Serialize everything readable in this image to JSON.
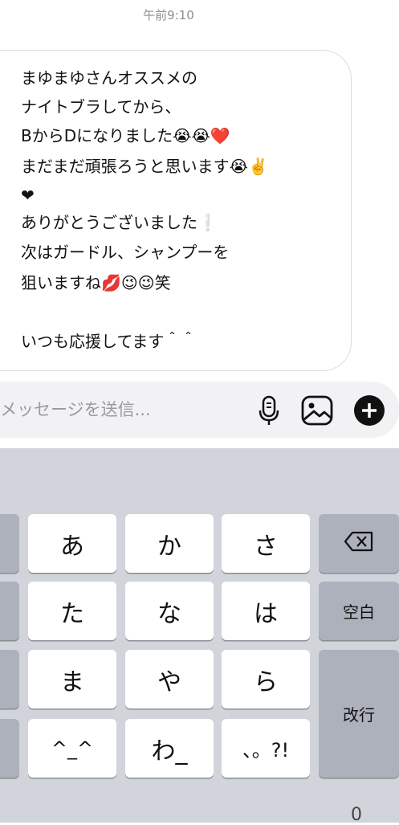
{
  "timestamp": "午前9:10",
  "message": {
    "lines": [
      "まゆまゆさんオススメの",
      "ナイトブラしてから、",
      "BからDになりました😭😭❤️",
      "まだまだ頑張ろうと思います😭✌️",
      "❤",
      "ありがとうございました❕",
      "次はガードル、シャンプーを",
      "狙いますね💋😉😉笑",
      "",
      "いつも応援してます＾＾"
    ]
  },
  "composer": {
    "placeholder": "メッセージを送信...",
    "icons": [
      "microphone-icon",
      "gallery-icon",
      "add-icon"
    ]
  },
  "keyboard": {
    "row1": [
      "あ",
      "か",
      "さ"
    ],
    "row2": [
      "た",
      "な",
      "は"
    ],
    "row3": [
      "ま",
      "や",
      "ら"
    ],
    "row4": [
      "^_^",
      "わ_",
      "、。?!"
    ],
    "space": "空白",
    "return": "改行",
    "backspace_icon": "backspace-icon",
    "bottom_glyph": "0"
  },
  "colors": {
    "keyboard_bg": "#d2d4dc",
    "key_white": "#ffffff",
    "key_gray": "#adb1bc",
    "bubble_border": "#dbdbdb",
    "composer_bg": "#f2f2f5",
    "add_button": "#111111"
  }
}
